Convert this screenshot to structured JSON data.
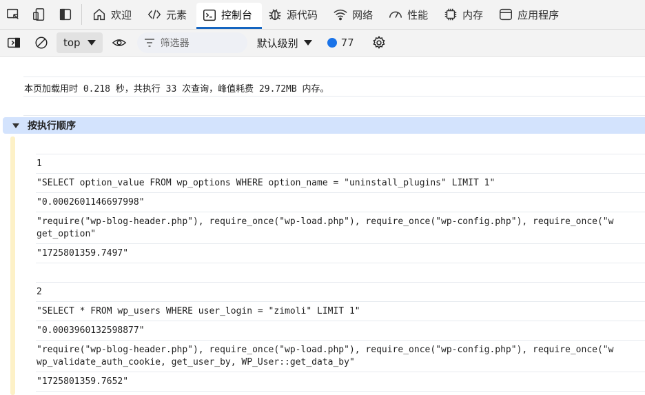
{
  "tabs": [
    {
      "label": "欢迎",
      "icon": "home-icon"
    },
    {
      "label": "元素",
      "icon": "code-brackets-icon"
    },
    {
      "label": "控制台",
      "icon": "console-icon",
      "active": true
    },
    {
      "label": "源代码",
      "icon": "bug-icon"
    },
    {
      "label": "网络",
      "icon": "wifi-icon"
    },
    {
      "label": "性能",
      "icon": "gauge-icon"
    },
    {
      "label": "内存",
      "icon": "chip-icon"
    },
    {
      "label": "应用程序",
      "icon": "app-window-icon"
    }
  ],
  "toolbar": {
    "context": "top",
    "filter_placeholder": "筛选器",
    "level": "默认级别",
    "message_count": "77"
  },
  "console": {
    "summary": "本页加载用时 0.218 秒，共执行 33 次查询，峰值耗费 29.72MB 内存。",
    "group_label": "按执行顺序",
    "entries": [
      {
        "index": "1",
        "sql": "\"SELECT option_value FROM wp_options WHERE option_name = \"uninstall_plugins\" LIMIT 1\"",
        "time": "\"0.0002601146697998\"",
        "trace1": "\"require(\"wp-blog-header.php\"), require_once(\"wp-load.php\"), require_once(\"wp-config.php\"), require_once(\"w",
        "trace2": "get_option\"",
        "timestamp": "\"1725801359.7497\""
      },
      {
        "index": "2",
        "sql": "\"SELECT * FROM wp_users WHERE user_login = \"zimoli\" LIMIT 1\"",
        "time": "\"0.0003960132598877\"",
        "trace1": "\"require(\"wp-blog-header.php\"), require_once(\"wp-load.php\"), require_once(\"wp-config.php\"), require_once(\"w",
        "trace2": "wp_validate_auth_cookie, get_user_by, WP_User::get_data_by\"",
        "timestamp": "\"1725801359.7652\""
      }
    ]
  },
  "colors": {
    "accent": "#1565c0",
    "group_bg": "#d3e3fd",
    "gutter": "#fdf1c7"
  }
}
